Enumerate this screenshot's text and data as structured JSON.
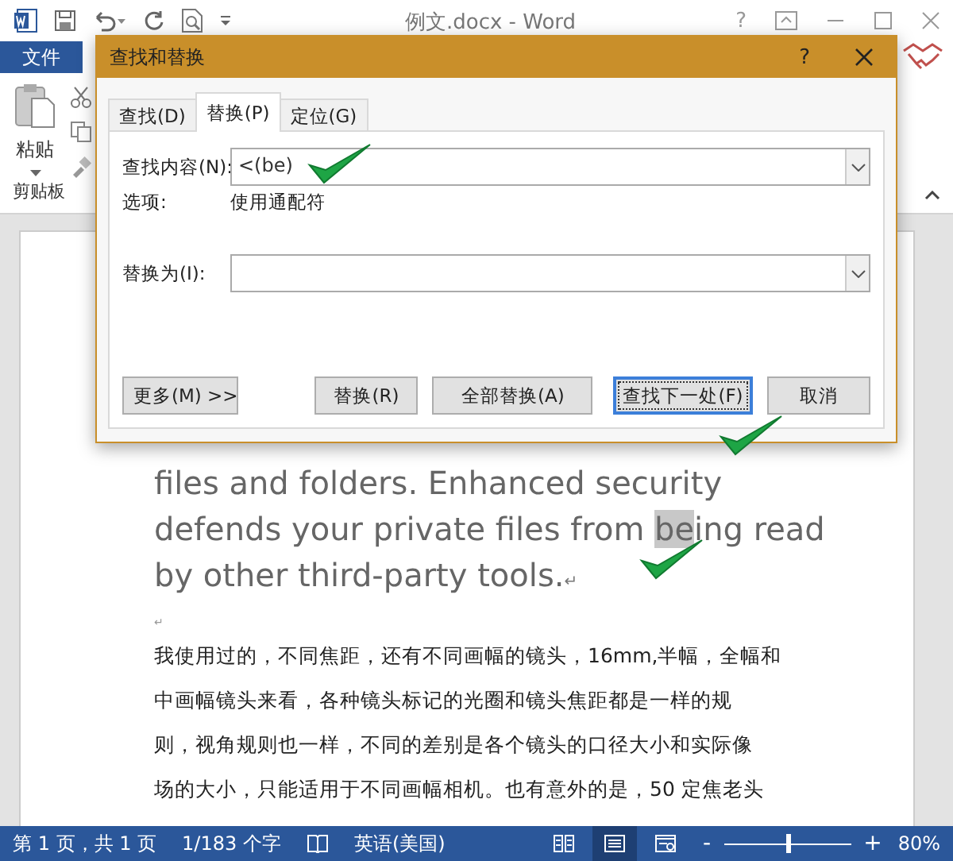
{
  "window": {
    "title": "例文.docx - Word",
    "help": "?"
  },
  "ribbon": {
    "file_tab": "文件",
    "paste_label": "粘贴",
    "group_label": "剪贴板"
  },
  "document": {
    "paragraphs": [
      {
        "kind": "latin",
        "segments": [
          {
            "text": "files and folders. Enhanced security",
            "highlighted": false
          }
        ]
      },
      {
        "kind": "latin",
        "segments": [
          {
            "text": "defends your private files from ",
            "highlighted": false
          },
          {
            "text": "be",
            "highlighted": true
          },
          {
            "text": "ing read",
            "highlighted": false
          }
        ]
      },
      {
        "kind": "latin",
        "segments": [
          {
            "text": "by other third-party tools.",
            "highlighted": false
          },
          {
            "text": "↵",
            "highlighted": false
          }
        ]
      },
      {
        "kind": "empty",
        "segments": [
          {
            "text": "↵",
            "highlighted": false
          }
        ]
      },
      {
        "kind": "cjk",
        "segments": [
          {
            "text": "我使用过的，不同焦距，还有不同画幅的镜头，16mm,半幅，全幅和",
            "highlighted": false
          }
        ]
      },
      {
        "kind": "cjk",
        "segments": [
          {
            "text": "中画幅镜头来看，各种镜头标记的光圈和镜头焦距都是一样的规",
            "highlighted": false
          }
        ]
      },
      {
        "kind": "cjk",
        "segments": [
          {
            "text": "则，视角规则也一样，不同的差别是各个镜头的口径大小和实际像",
            "highlighted": false
          }
        ]
      },
      {
        "kind": "cjk",
        "segments": [
          {
            "text": "场的大小，只能适用于不同画幅相机。也有意外的是，50 定焦老头",
            "highlighted": false
          }
        ]
      }
    ]
  },
  "dialog": {
    "title": "查找和替换",
    "help": "?",
    "tabs": [
      {
        "label": "查找(D)",
        "selected": false
      },
      {
        "label": "替换(P)",
        "selected": true
      },
      {
        "label": "定位(G)",
        "selected": false
      }
    ],
    "find": {
      "label": "查找内容(N):",
      "value": "<(be)"
    },
    "options": {
      "label": "选项:",
      "value": "使用通配符"
    },
    "replace": {
      "label": "替换为(I):"
    },
    "buttons": [
      {
        "label": "更多(M) >>",
        "focused": false
      },
      {
        "label": "替换(R)",
        "focused": false
      },
      {
        "label": "全部替换(A)",
        "focused": false
      },
      {
        "label": "查找下一处(F)",
        "focused": true
      },
      {
        "label": "取消",
        "focused": false
      }
    ]
  },
  "status_bar": {
    "page": "第 1 页，共 1 页",
    "words": "1/183 个字",
    "language": "英语(美国)",
    "views": [
      {
        "selected": false
      },
      {
        "selected": true
      },
      {
        "selected": false
      }
    ],
    "zoom": {
      "minus": "-",
      "plus": "+",
      "level": 0.5,
      "reading": "80%"
    }
  }
}
